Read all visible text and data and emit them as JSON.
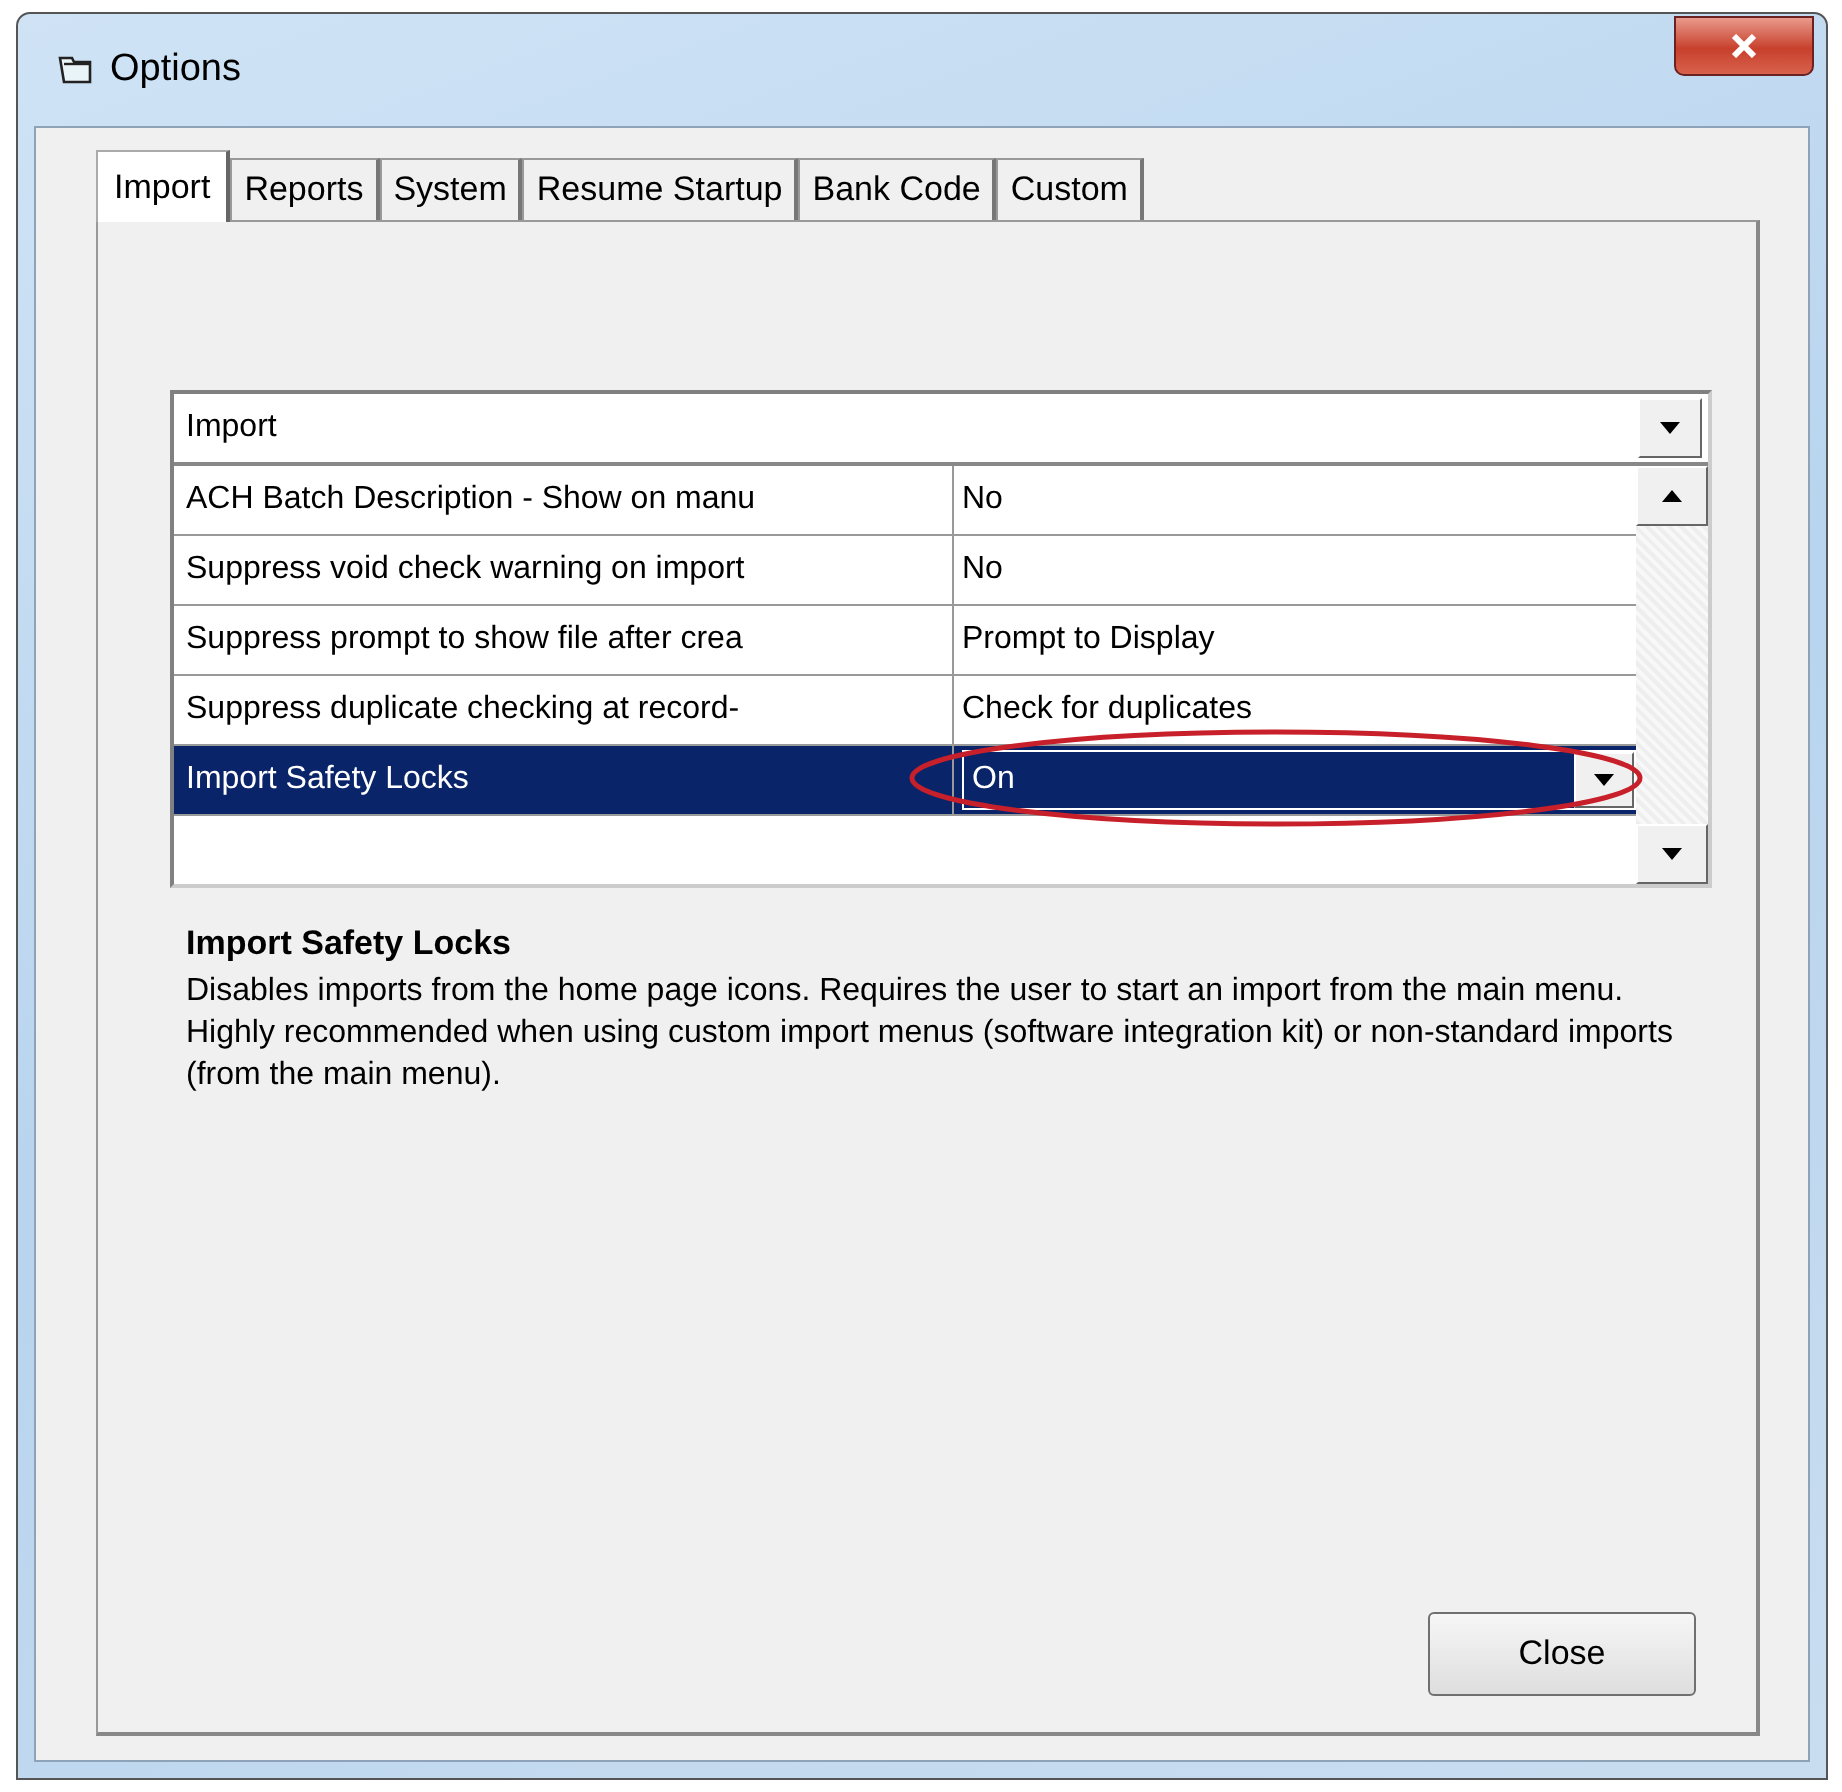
{
  "window": {
    "title": "Options"
  },
  "tabs": [
    {
      "label": "Import",
      "selected": true
    },
    {
      "label": "Reports",
      "selected": false
    },
    {
      "label": "System",
      "selected": false
    },
    {
      "label": "Resume Startup",
      "selected": false
    },
    {
      "label": "Bank Code",
      "selected": false
    },
    {
      "label": "Custom",
      "selected": false
    }
  ],
  "category_dropdown": {
    "value": "Import"
  },
  "properties": [
    {
      "name": "ACH Batch Description - Show on manu",
      "value": "No",
      "selected": false
    },
    {
      "name": "Suppress void check warning on import",
      "value": "No",
      "selected": false
    },
    {
      "name": "Suppress prompt to show file after crea",
      "value": "Prompt to Display",
      "selected": false
    },
    {
      "name": "Suppress duplicate checking at record-",
      "value": "Check for duplicates",
      "selected": false
    },
    {
      "name": "Import Safety Locks",
      "value": "On",
      "selected": true
    }
  ],
  "description": {
    "title": "Import Safety Locks",
    "text": "Disables imports from the home page icons.  Requires the user to start an import from the main menu.  Highly recommended when using custom import menus (software integration kit) or non-standard imports (from the main menu)."
  },
  "buttons": [
    "Close"
  ]
}
